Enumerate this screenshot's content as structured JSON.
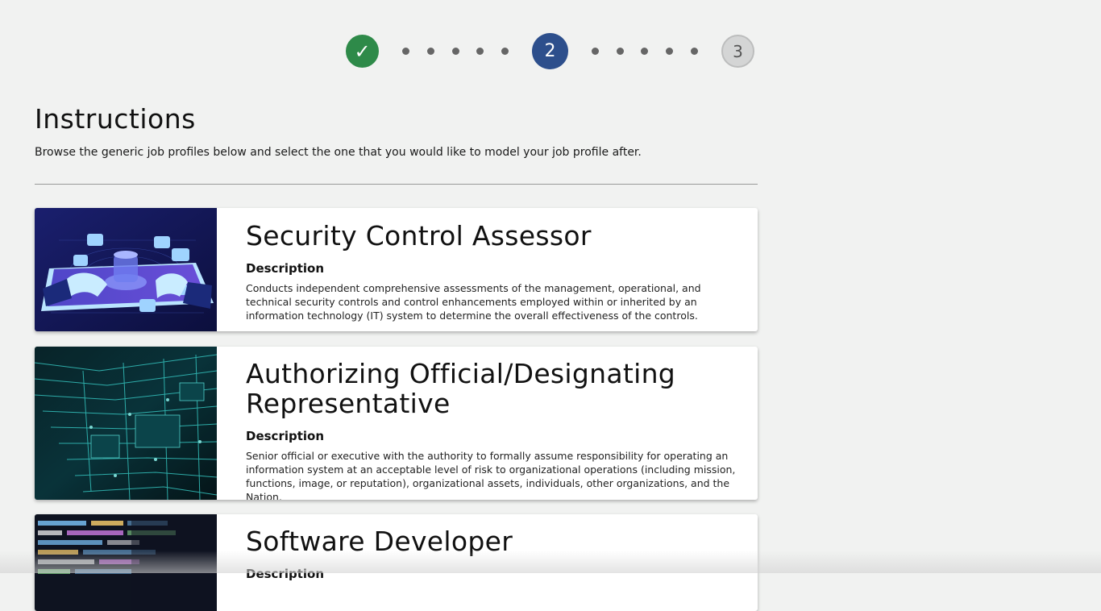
{
  "stepper": {
    "step1": {
      "label": "✓",
      "status": "complete",
      "color": "#2e8a49"
    },
    "step2": {
      "label": "2",
      "status": "current",
      "color": "#2d4f8c"
    },
    "step3": {
      "label": "3",
      "status": "upcoming",
      "color": "#d4d5d5"
    }
  },
  "instructions": {
    "title": "Instructions",
    "text": "Browse the generic job profiles below and select the one that you would like to model your job profile after."
  },
  "profiles": [
    {
      "title": "Security Control Assessor",
      "description_label": "Description",
      "description": "Conducts independent comprehensive assessments of the management, operational, and technical security controls and control enhancements employed within or inherited by an information technology (IT) system to determine the overall effectiveness of the controls.",
      "image": "hands-tablet-illustration"
    },
    {
      "title": "Authorizing Official/Designating Representative",
      "description_label": "Description",
      "description": "Senior official or executive with the authority to formally assume responsibility for operating an information system at an acceptable level of risk to organizational operations (including mission, functions, image, or reputation), organizational assets, individuals, other organizations, and the Nation.",
      "image": "circuit-board-photo"
    },
    {
      "title": "Software Developer",
      "description_label": "Description",
      "description": "",
      "image": "source-code-photo"
    }
  ]
}
